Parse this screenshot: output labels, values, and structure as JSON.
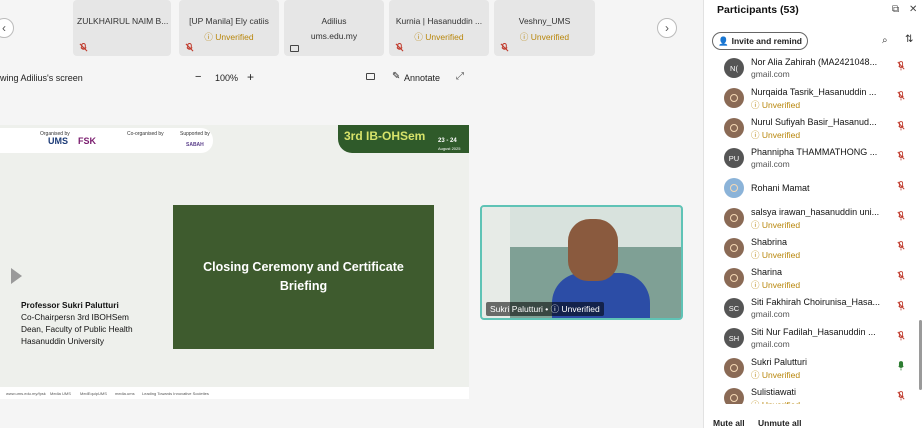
{
  "strip": {
    "tiles": [
      {
        "name": "ZULKHAIRUL NAIM B...",
        "status": ""
      },
      {
        "name": "[UP Manila] Ely catiis",
        "status": "Unverified"
      },
      {
        "name": "Adilius",
        "status": "ums.edu.my"
      },
      {
        "name": "Kurnia | Hasanuddin ...",
        "status": "Unverified"
      },
      {
        "name": "Veshny_UMS",
        "status": "Unverified"
      }
    ]
  },
  "toolbar": {
    "viewing_label": "wing Adilius's screen",
    "zoom_out": "−",
    "zoom_value": "100%",
    "zoom_in": "+",
    "annotate_label": "Annotate"
  },
  "slide": {
    "logos": [
      "Organised by",
      "UMS",
      "FSK",
      "Co-organised by",
      "Supported by",
      "SABAH"
    ],
    "banner_title": "3rd IB-OHSem",
    "date_main": "23 - 24",
    "date_sub": "August 2025",
    "main_text": "Closing Ceremony and Certificate Briefing",
    "speaker": {
      "name": "Professor Sukri Palutturi",
      "line1": "Co-Chairpersn 3rd IBOHSem",
      "line2": "Dean, Faculty of Public Health",
      "line3": "Hasanuddin University"
    },
    "footer": [
      "www.ums.edu.my/fpsk",
      "Media UMS",
      "MedEquipUMS",
      "media.ums",
      "Leading Towards Innovative Societies"
    ]
  },
  "video": {
    "label": "Sukri Palutturi • ⓘ Unverified"
  },
  "participants": {
    "title": "Participants (53)",
    "invite_label": "Invite and remind",
    "list": [
      {
        "initials": "N(",
        "name": "Nor Alia Zahirah (MA2421048...",
        "sub": "gmail.com",
        "unverified": false,
        "avatar": "gray"
      },
      {
        "initials": "",
        "name": "Nurqaida Tasrik_Hasanuddin ...",
        "sub": "ⓘ Unverified",
        "unverified": true,
        "avatar": "brown"
      },
      {
        "initials": "",
        "name": "Nurul Sufiyah Basir_Hasanud...",
        "sub": "ⓘ Unverified",
        "unverified": true,
        "avatar": "brown"
      },
      {
        "initials": "PU",
        "name": "Phannipha THAMMATHONG ...",
        "sub": "gmail.com",
        "unverified": false,
        "avatar": "gray"
      },
      {
        "initials": "",
        "name": "Rohani Mamat",
        "sub": "",
        "unverified": false,
        "avatar": "photo"
      },
      {
        "initials": "",
        "name": "salsya irawan_hasanuddin uni...",
        "sub": "ⓘ Unverified",
        "unverified": true,
        "avatar": "brown"
      },
      {
        "initials": "",
        "name": "Shabrina",
        "sub": "ⓘ Unverified",
        "unverified": true,
        "avatar": "brown"
      },
      {
        "initials": "",
        "name": "Sharina",
        "sub": "ⓘ Unverified",
        "unverified": true,
        "avatar": "brown"
      },
      {
        "initials": "SC",
        "name": "Siti Fakhirah Choirunisa_Hasa...",
        "sub": "gmail.com",
        "unverified": false,
        "avatar": "gray"
      },
      {
        "initials": "SH",
        "name": "Siti Nur Fadilah_Hasanuddin ...",
        "sub": "gmail.com",
        "unverified": false,
        "avatar": "gray"
      },
      {
        "initials": "",
        "name": "Sukri Palutturi",
        "sub": "ⓘ Unverified",
        "unverified": true,
        "avatar": "brown",
        "mic_active": true
      },
      {
        "initials": "",
        "name": "Sulistiawati",
        "sub": "ⓘ Unverified",
        "unverified": true,
        "avatar": "brown"
      }
    ],
    "mute_all": "Mute all",
    "unmute_all": "Unmute all"
  },
  "colors": {
    "unverified": "#b8860b",
    "muted_mic": "#c0392b",
    "video_border": "#5fc3b6",
    "slide_green": "#3e5b2e"
  }
}
